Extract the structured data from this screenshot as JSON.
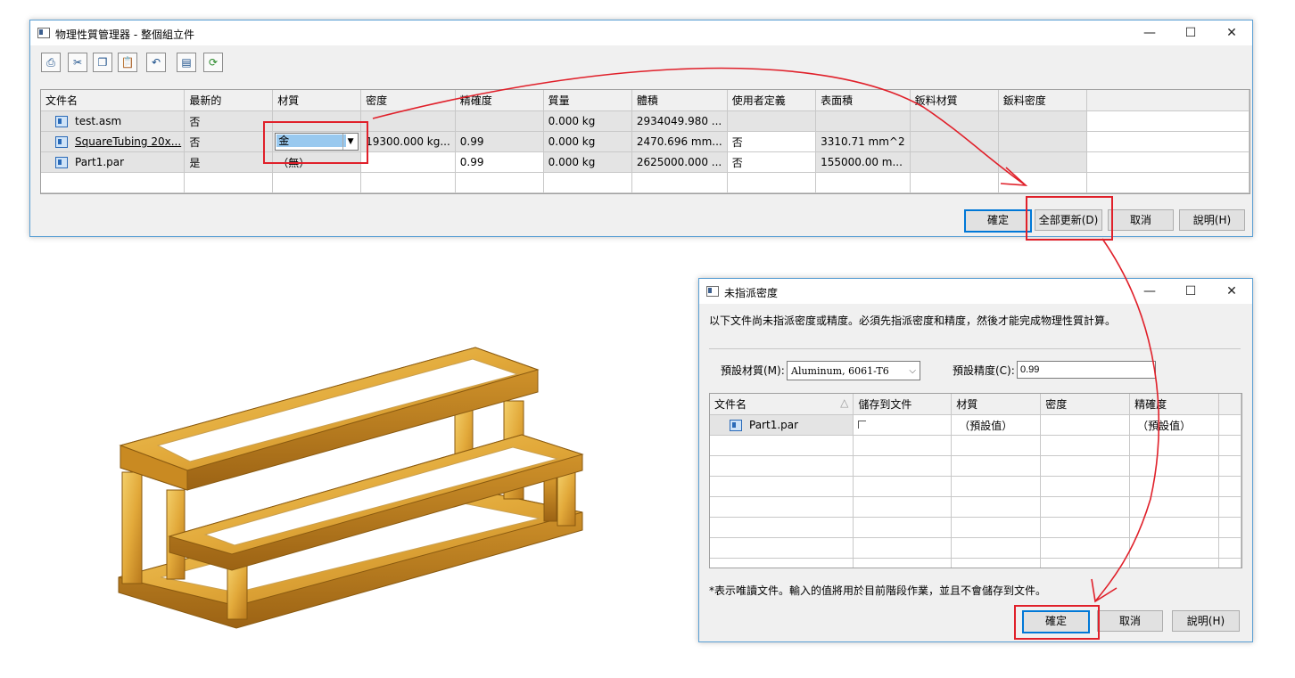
{
  "dialog1": {
    "title": "物理性質管理器 - 整個組立件",
    "window_controls": {
      "minimize": "—",
      "maximize": "☐",
      "close": "✕"
    },
    "toolbar": [
      "print-icon",
      "cut-icon",
      "copy-icon",
      "paste-icon",
      "undo-icon",
      "properties-icon",
      "refresh-icon"
    ],
    "columns": [
      "文件名",
      "最新的",
      "材質",
      "密度",
      "精確度",
      "質量",
      "體積",
      "使用者定義",
      "表面積",
      "鈑料材質",
      "鈑料密度"
    ],
    "rows": [
      {
        "name": "test.asm",
        "latest": "否",
        "material": "",
        "density": "",
        "accuracy": "",
        "mass": "0.000 kg",
        "volume": "2934049.980 ...",
        "user": "",
        "area": "",
        "sm_mat": "",
        "sm_den": ""
      },
      {
        "name": "SquareTubing 20x...",
        "latest": "否",
        "material": "金",
        "density": "19300.000 kg...",
        "accuracy": "0.99",
        "mass": "0.000 kg",
        "volume": "2470.696 mm...",
        "user": "否",
        "area": "3310.71 mm^2",
        "sm_mat": "",
        "sm_den": ""
      },
      {
        "name": "Part1.par",
        "latest": "是",
        "material": "（無）",
        "density": "",
        "accuracy": "0.99",
        "mass": "0.000 kg",
        "volume": "2625000.000 ...",
        "user": "否",
        "area": "155000.00 m...",
        "sm_mat": "",
        "sm_den": ""
      }
    ],
    "buttons": {
      "ok": "確定",
      "update_all": "全部更新(D)",
      "cancel": "取消",
      "help": "說明(H)"
    }
  },
  "dialog2": {
    "title": "未指派密度",
    "window_controls": {
      "minimize": "—",
      "maximize": "☐",
      "close": "✕"
    },
    "message": "以下文件尚未指派密度或精度。必須先指派密度和精度，然後才能完成物理性質計算。",
    "default_material_label": "預設材質(M):",
    "default_material_value": "Aluminum, 6061-T6",
    "default_accuracy_label": "預設精度(C):",
    "default_accuracy_value": "0.99",
    "columns": [
      "文件名",
      "儲存到文件",
      "材質",
      "密度",
      "精確度"
    ],
    "rows": [
      {
        "name": "Part1.par",
        "save": "",
        "material": "（預設值）",
        "density": "",
        "accuracy": "（預設值）"
      }
    ],
    "footnote": "*表示唯讀文件。輸入的值將用於目前階段作業，並且不會儲存到文件。",
    "buttons": {
      "ok": "確定",
      "cancel": "取消",
      "help": "說明(H)"
    }
  },
  "colors": {
    "annotation_red": "#e0202a",
    "accent_blue": "#0078d7",
    "gold_model": "#e2a93a"
  }
}
